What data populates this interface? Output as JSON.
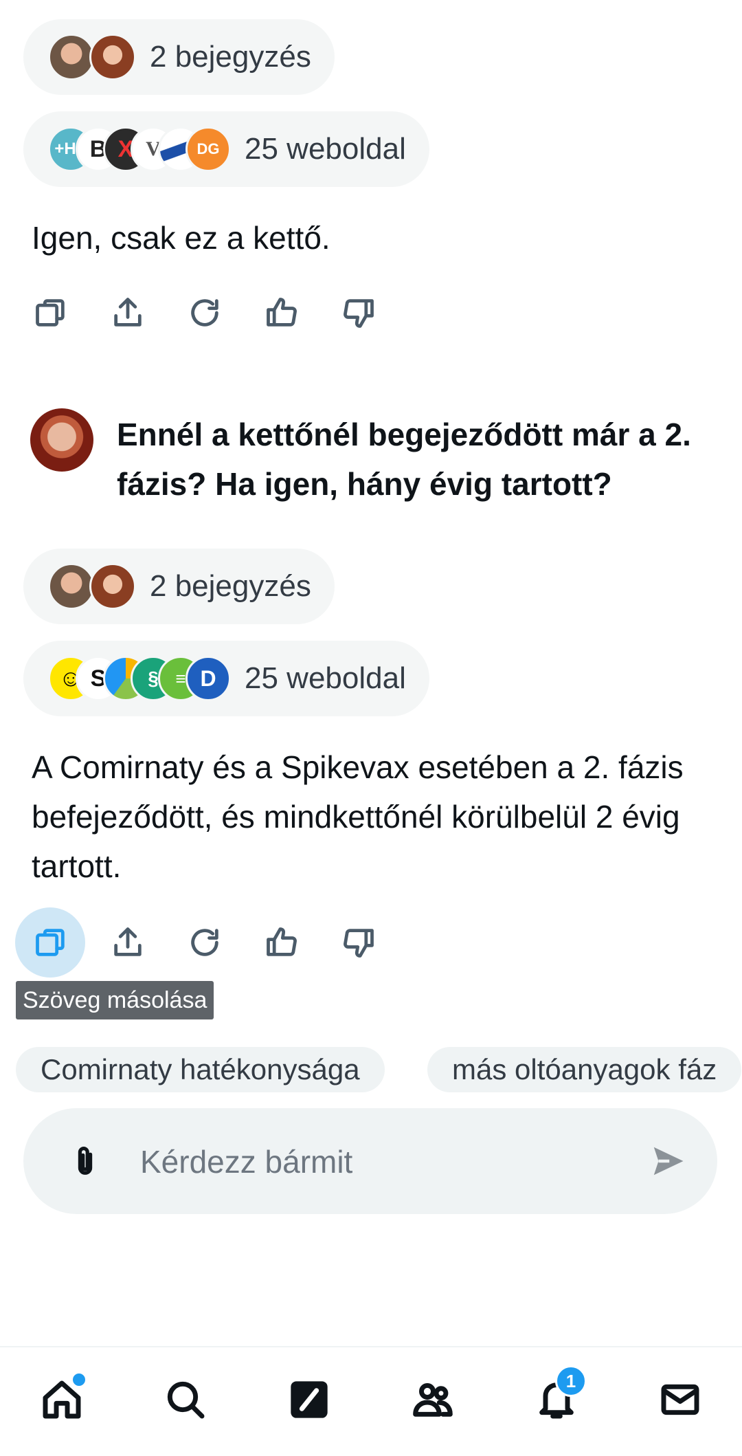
{
  "thread": {
    "first_answer": {
      "posts_label": "2 bejegyzés",
      "sites_label": "25 weboldal",
      "site_favicons": [
        "HP",
        "B",
        "V",
        "flag",
        "DG"
      ],
      "text": "Igen, csak ez a kettő."
    },
    "question": {
      "text": "Ennél a kettőnél begejeződött már a 2. fázis? Ha igen, hány évig tartott?"
    },
    "second_answer": {
      "posts_label": "2 bejegyzés",
      "sites_label": "25 weboldal",
      "site_favicons": [
        "smiley",
        "S",
        "pie",
        "§",
        "book",
        "D"
      ],
      "text": "A Comirnaty és a Spikevax esetében a 2. fázis befejeződött, és mindkettőnél körülbelül 2 évig tartott."
    }
  },
  "actions": {
    "copy": "copy-icon",
    "share": "share-icon",
    "regenerate": "refresh-icon",
    "like": "thumbs-up-icon",
    "dislike": "thumbs-down-icon"
  },
  "tooltip": "Szöveg másolása",
  "suggestions": [
    "Comirnaty hatékonysága",
    "más oltóanyagok fáz"
  ],
  "composer": {
    "placeholder": "Kérdezz bármit",
    "value": ""
  },
  "bottom_nav": {
    "items": [
      "home-icon",
      "search-icon",
      "grok-icon",
      "communities-icon",
      "notifications-icon",
      "messages-icon"
    ],
    "notifications_badge": "1",
    "home_has_dot": true
  },
  "colors": {
    "accent": "#1d9bf0",
    "pill_bg": "#f4f6f6",
    "icon_gray": "#4b5b69"
  }
}
